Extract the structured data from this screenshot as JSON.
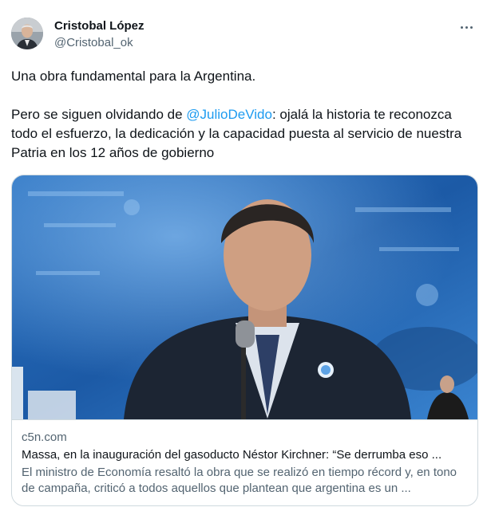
{
  "author": {
    "display_name": "Cristobal López",
    "handle": "@Cristobal_ok",
    "avatar_icon": "profile-photo"
  },
  "more_icon": "ellipsis-icon",
  "tweet": {
    "line1": "Una obra fundamental para la Argentina.",
    "line2_before": "Pero se siguen olvidando de ",
    "mention": "@JulioDeVido",
    "line2_after": ": ojalá la historia te reconozca todo el esfuerzo, la dedicación y la capacidad puesta al servicio de nuestra Patria en los 12 años de gobierno"
  },
  "card": {
    "domain": "c5n.com",
    "title": "Massa, en la inauguración del gasoducto Néstor Kirchner: “Se derrumba eso ...",
    "description": "El ministro de Economía resaltó la obra que se realizó en tiempo récord y, en tono de campaña, criticó a todos aquellos que plantean que argentina es un ..."
  },
  "colors": {
    "text": "#0f1419",
    "secondary": "#536471",
    "link": "#1d9bf0",
    "border": "#cfd9de",
    "image_background": "#1f5fa8"
  }
}
